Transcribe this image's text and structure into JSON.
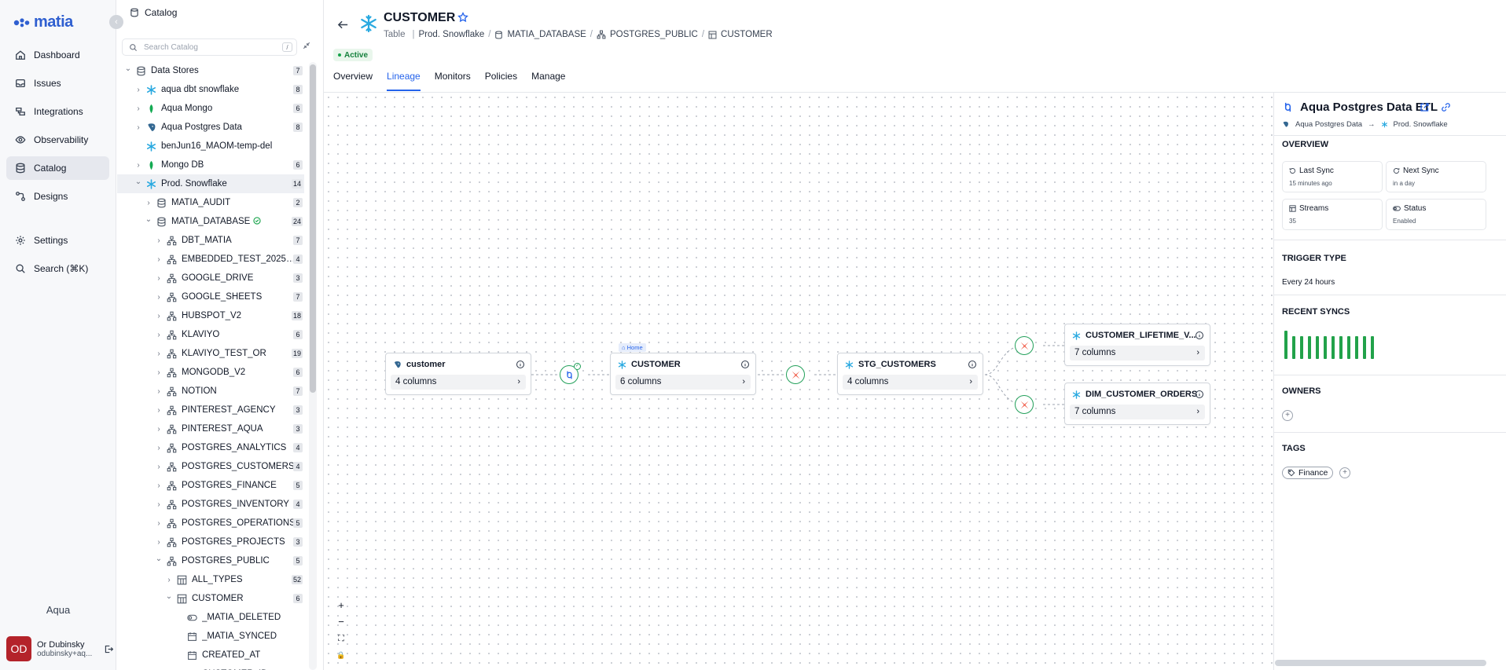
{
  "app": {
    "logo_text": "matia",
    "workspace": "Aqua"
  },
  "nav": {
    "items": [
      {
        "label": "Dashboard",
        "icon": "home-icon"
      },
      {
        "label": "Issues",
        "icon": "inbox-icon"
      },
      {
        "label": "Integrations",
        "icon": "integrations-icon"
      },
      {
        "label": "Observability",
        "icon": "eye-icon"
      },
      {
        "label": "Catalog",
        "icon": "database-icon",
        "active": true
      },
      {
        "label": "Designs",
        "icon": "designs-icon"
      },
      {
        "label": "Settings",
        "icon": "gear-icon"
      },
      {
        "label": "Search (⌘K)",
        "icon": "search-icon"
      }
    ]
  },
  "user": {
    "initials": "OD",
    "name": "Or Dubinsky",
    "email": "odubinsky+aq..."
  },
  "catalog": {
    "title": "Catalog",
    "search_placeholder": "Search Catalog",
    "search_shortcut": "/",
    "rows": [
      {
        "label": "Data Stores",
        "count": "7",
        "depth": 0,
        "chev": "v",
        "icon": "database"
      },
      {
        "label": "aqua dbt snowflake",
        "count": "8",
        "depth": 1,
        "chev": ">",
        "icon": "snowflake"
      },
      {
        "label": "Aqua Mongo",
        "count": "6",
        "depth": 1,
        "chev": ">",
        "icon": "mongo"
      },
      {
        "label": "Aqua Postgres Data",
        "count": "8",
        "depth": 1,
        "chev": ">",
        "icon": "postgres"
      },
      {
        "label": "benJun16_MAOM-temp-del",
        "count": "",
        "depth": 1,
        "chev": "",
        "icon": "snowflake"
      },
      {
        "label": "Mongo DB",
        "count": "6",
        "depth": 1,
        "chev": ">",
        "icon": "mongo"
      },
      {
        "label": "Prod. Snowflake",
        "count": "14",
        "depth": 1,
        "chev": "v",
        "icon": "snowflake",
        "selected": true
      },
      {
        "label": "MATIA_AUDIT",
        "count": "2",
        "depth": 2,
        "chev": ">",
        "icon": "database"
      },
      {
        "label": "MATIA_DATABASE",
        "count": "24",
        "depth": 2,
        "chev": "v",
        "icon": "database",
        "check": true
      },
      {
        "label": "DBT_MATIA",
        "count": "7",
        "depth": 3,
        "chev": ">",
        "icon": "schema"
      },
      {
        "label": "EMBEDDED_TEST_202507...",
        "count": "4",
        "depth": 3,
        "chev": ">",
        "icon": "schema"
      },
      {
        "label": "GOOGLE_DRIVE",
        "count": "3",
        "depth": 3,
        "chev": ">",
        "icon": "schema"
      },
      {
        "label": "GOOGLE_SHEETS",
        "count": "7",
        "depth": 3,
        "chev": ">",
        "icon": "schema"
      },
      {
        "label": "HUBSPOT_V2",
        "count": "18",
        "depth": 3,
        "chev": ">",
        "icon": "schema"
      },
      {
        "label": "KLAVIYO",
        "count": "6",
        "depth": 3,
        "chev": ">",
        "icon": "schema"
      },
      {
        "label": "KLAVIYO_TEST_OR",
        "count": "19",
        "depth": 3,
        "chev": ">",
        "icon": "schema"
      },
      {
        "label": "MONGODB_V2",
        "count": "6",
        "depth": 3,
        "chev": ">",
        "icon": "schema"
      },
      {
        "label": "NOTION",
        "count": "7",
        "depth": 3,
        "chev": ">",
        "icon": "schema"
      },
      {
        "label": "PINTEREST_AGENCY",
        "count": "3",
        "depth": 3,
        "chev": ">",
        "icon": "schema"
      },
      {
        "label": "PINTEREST_AQUA",
        "count": "3",
        "depth": 3,
        "chev": ">",
        "icon": "schema"
      },
      {
        "label": "POSTGRES_ANALYTICS",
        "count": "4",
        "depth": 3,
        "chev": ">",
        "icon": "schema"
      },
      {
        "label": "POSTGRES_CUSTOMERS",
        "count": "4",
        "depth": 3,
        "chev": ">",
        "icon": "schema"
      },
      {
        "label": "POSTGRES_FINANCE",
        "count": "5",
        "depth": 3,
        "chev": ">",
        "icon": "schema"
      },
      {
        "label": "POSTGRES_INVENTORY",
        "count": "4",
        "depth": 3,
        "chev": ">",
        "icon": "schema"
      },
      {
        "label": "POSTGRES_OPERATIONS",
        "count": "5",
        "depth": 3,
        "chev": ">",
        "icon": "schema"
      },
      {
        "label": "POSTGRES_PROJECTS",
        "count": "3",
        "depth": 3,
        "chev": ">",
        "icon": "schema"
      },
      {
        "label": "POSTGRES_PUBLIC",
        "count": "5",
        "depth": 3,
        "chev": "v",
        "icon": "schema"
      },
      {
        "label": "ALL_TYPES",
        "count": "52",
        "depth": 4,
        "chev": ">",
        "icon": "table"
      },
      {
        "label": "CUSTOMER",
        "count": "6",
        "depth": 4,
        "chev": "v",
        "icon": "table"
      },
      {
        "label": "_MATIA_DELETED",
        "count": "",
        "depth": 5,
        "chev": "",
        "icon": "bool"
      },
      {
        "label": "_MATIA_SYNCED",
        "count": "",
        "depth": 5,
        "chev": "",
        "icon": "calendar"
      },
      {
        "label": "CREATED_AT",
        "count": "",
        "depth": 5,
        "chev": "",
        "icon": "calendar"
      },
      {
        "label": "CUSTOMER_ID",
        "count": "",
        "depth": 5,
        "chev": "",
        "icon": "hash"
      }
    ]
  },
  "entity": {
    "title": "CUSTOMER",
    "type": "Table",
    "crumbs": [
      "Prod. Snowflake",
      "MATIA_DATABASE",
      "POSTGRES_PUBLIC",
      "CUSTOMER"
    ],
    "status": "Active"
  },
  "tabs": [
    "Overview",
    "Lineage",
    "Monitors",
    "Policies",
    "Manage"
  ],
  "active_tab": "Lineage",
  "lineage": {
    "nodes": [
      {
        "name": "customer",
        "columns": "4 columns",
        "icon": "postgres"
      },
      {
        "name": "CUSTOMER",
        "columns": "6 columns",
        "icon": "snowflake",
        "tag": "Home"
      },
      {
        "name": "STG_CUSTOMERS",
        "columns": "4 columns",
        "icon": "snowflake"
      },
      {
        "name": "CUSTOMER_LIFETIME_V...",
        "columns": "7 columns",
        "icon": "snowflake"
      },
      {
        "name": "DIM_CUSTOMER_ORDERS",
        "columns": "7 columns",
        "icon": "snowflake"
      }
    ],
    "zoom_controls": [
      "+",
      "−",
      "⛶",
      "🔒"
    ]
  },
  "panel": {
    "title": "Aqua Postgres Data ETL",
    "source": "Aqua Postgres Data",
    "destination": "Prod. Snowflake",
    "overview_heading": "OVERVIEW",
    "cards": [
      {
        "label": "Last Sync",
        "value": "15 minutes ago",
        "icon": "history-icon"
      },
      {
        "label": "Next Sync",
        "value": "in a day",
        "icon": "redo-icon"
      },
      {
        "label": "Streams",
        "value": "35",
        "icon": "table-icon"
      },
      {
        "label": "Status",
        "value": "Enabled",
        "icon": "toggle-icon"
      }
    ],
    "trigger_heading": "TRIGGER TYPE",
    "trigger_value": "Every 24 hours",
    "recent_heading": "RECENT SYNCS",
    "recent_syncs": [
      1,
      0.8,
      0.8,
      0.8,
      0.8,
      0.8,
      0.8,
      0.8,
      0.8,
      0.8,
      0.8,
      0.8
    ],
    "owners_heading": "OWNERS",
    "tags_heading": "TAGS",
    "tags": [
      "Finance"
    ],
    "colors": {
      "sync_success": "#22a24a",
      "accent": "#2563eb"
    }
  }
}
